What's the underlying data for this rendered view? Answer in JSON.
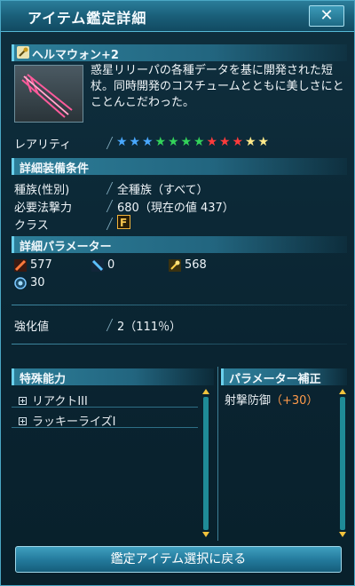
{
  "window": {
    "title": "アイテム鑑定詳細",
    "close_label": "✕"
  },
  "item": {
    "name": "ヘルマウォン+2",
    "description": "惑星リリーパの各種データを基に開発された短杖。同時開発のコスチュームとともに美しさにとことんこだわった。",
    "rarity_label": "レアリティ",
    "rarity_stars": 12,
    "rarity_colors": [
      "#49a8ff",
      "#49a8ff",
      "#49a8ff",
      "#33d35a",
      "#33d35a",
      "#33d35a",
      "#33d35a",
      "#ff3b3b",
      "#ff3b3b",
      "#ff3b3b",
      "#ffe98a",
      "#ffe98a"
    ]
  },
  "equip": {
    "header": "詳細装備条件",
    "race_label": "種族(性別)",
    "race_value": "全種族（すべて）",
    "req_label": "必要法撃力",
    "req_value": "680（現在の値 437）",
    "class_label": "クラス",
    "class_icon": "force-class-icon"
  },
  "params": {
    "header": "詳細パラメーター",
    "atk": "577",
    "r_atk": "0",
    "t_atk": "568",
    "pp": "30"
  },
  "grind": {
    "label": "強化値",
    "value": "2（111％）"
  },
  "special": {
    "header": "特殊能力",
    "items": [
      "リアクトIII",
      "ラッキーライズI"
    ]
  },
  "bonus": {
    "header": "パラメーター補正",
    "name": "射撃防御",
    "value": "（+30）"
  },
  "footer": {
    "back_label": "鑑定アイテム選択に戻る"
  }
}
